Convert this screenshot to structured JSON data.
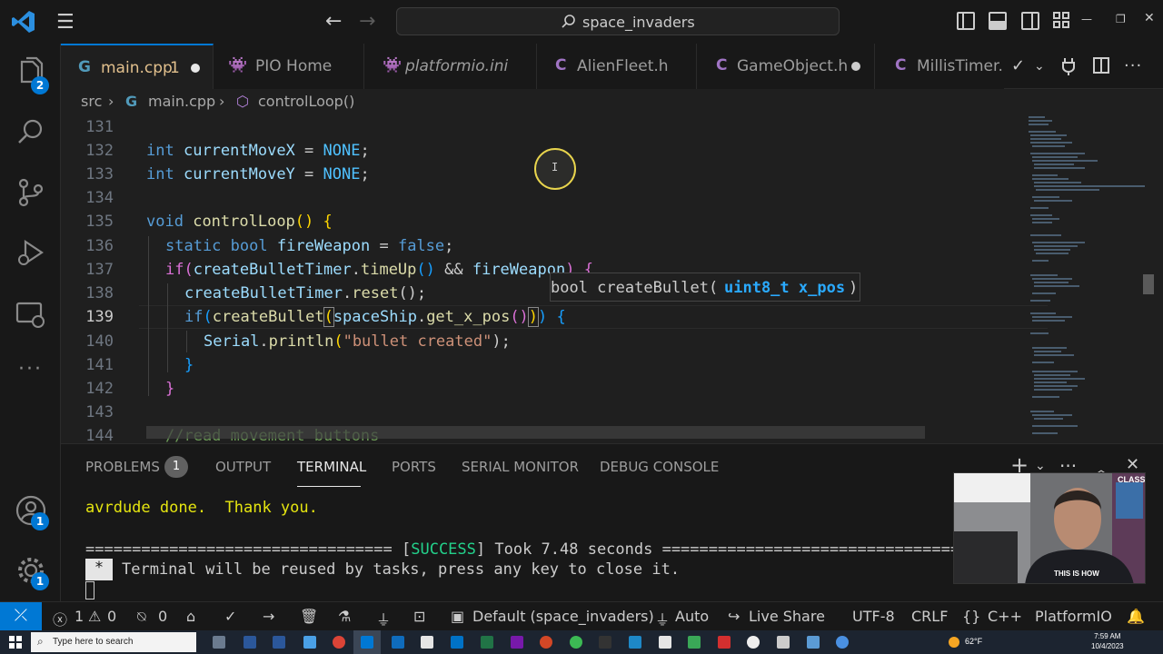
{
  "titlebar": {
    "search_text": "space_invaders"
  },
  "activitybar": {
    "explorer_badge": "2",
    "accounts_badge": "1",
    "manage_badge": "1"
  },
  "tabs": [
    {
      "label": "main.cpp",
      "modified_mark": "1",
      "icon": "cpp-icon"
    },
    {
      "label": "PIO Home",
      "icon": "pio-alien-icon"
    },
    {
      "label": "platformio.ini",
      "icon": "pio-alien-icon"
    },
    {
      "label": "AlienFleet.h",
      "icon": "c-header-icon"
    },
    {
      "label": "GameObject.h",
      "icon": "c-header-icon"
    },
    {
      "label": "MillisTimer.h",
      "icon": "c-header-icon"
    }
  ],
  "breadcrumb": {
    "folder": "src",
    "file": "main.cpp",
    "symbol": "controlLoop()"
  },
  "editor": {
    "line_numbers": [
      "131",
      "132",
      "133",
      "134",
      "135",
      "136",
      "137",
      "138",
      "139",
      "140",
      "141",
      "142",
      "143",
      "144"
    ],
    "current_line": "139",
    "lines": {
      "l132": {
        "type": "int",
        "name": "currentMoveX",
        "op": " = ",
        "val": "NONE",
        "end": ";"
      },
      "l133": {
        "type": "int",
        "name": "currentMoveY",
        "op": " = ",
        "val": "NONE",
        "end": ";"
      },
      "l135": {
        "type": "void",
        "name": "controlLoop",
        "paren": "()",
        "brace": "{"
      },
      "l136": {
        "kw1": "static",
        "kw2": "bool",
        "name": "fireWeapon",
        "op": " = ",
        "val": "false",
        "end": ";"
      },
      "l137": {
        "kw": "if",
        "obj": "createBulletTimer",
        "fn": "timeUp",
        "op": " && ",
        "var": "fireWeapon",
        "brace": "{"
      },
      "l138": {
        "obj": "createBulletTimer",
        "fn": "reset",
        "end": "();"
      },
      "l139": {
        "kw": "if",
        "fn": "createBullet",
        "obj": "spaceShip",
        "fn2": "get_x_pos",
        "brace": "{"
      },
      "l140": {
        "obj": "Serial",
        "fn": "println",
        "str": "\"bullet created\"",
        "end": ");"
      },
      "l141": {
        "brace": "}"
      },
      "l142": {
        "brace": "}"
      },
      "l144": {
        "comment": "//read movement buttons"
      }
    },
    "signature_help": {
      "prefix": "bool createBullet(",
      "param": "uint8_t x_pos",
      "suffix": ")"
    }
  },
  "panel": {
    "tabs": [
      "PROBLEMS",
      "OUTPUT",
      "TERMINAL",
      "PORTS",
      "SERIAL MONITOR",
      "DEBUG CONSOLE"
    ],
    "problems_count": "1",
    "terminal": {
      "line1": "avrdude done.  Thank you.",
      "success_left": "================================= [",
      "success_word": "SUCCESS",
      "success_right": "] Took 7.48 seconds =====================================",
      "star": "*",
      "reuse": "Terminal will be reused by tasks, press any key to close it."
    }
  },
  "webcam": {
    "shirt_text": "THIS IS HOW",
    "poster_text": "CLASS"
  },
  "statusbar": {
    "errors": "1",
    "warnings": "0",
    "ports": "0",
    "env": "Default (space_invaders)",
    "upload_port": "Auto",
    "live_share": "Live Share",
    "encoding": "UTF-8",
    "eol": "CRLF",
    "language": "C++",
    "platform": "PlatformIO"
  },
  "taskbar": {
    "search_placeholder": "Type here to search",
    "temperature": "62°F",
    "time": "7:59 AM",
    "date": "10/4/2023"
  },
  "colors": {
    "accent": "#0078d4",
    "success": "#23d18b",
    "terminal_yellow": "#e5e510"
  }
}
